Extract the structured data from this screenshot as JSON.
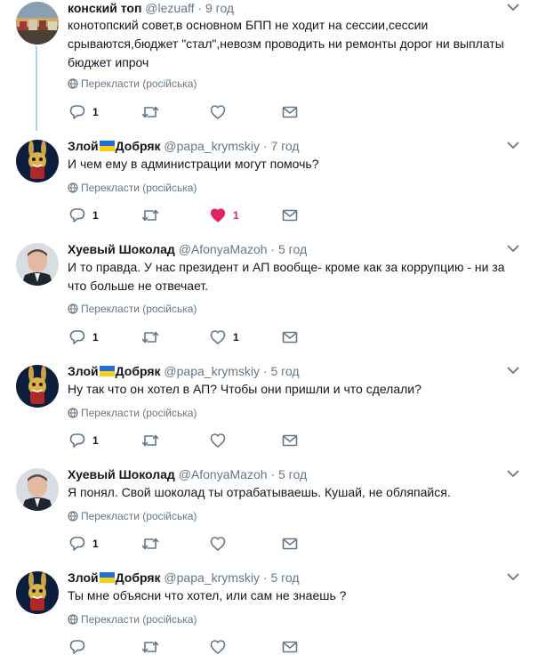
{
  "icons": {
    "reply": "reply-icon",
    "retweet": "retweet-icon",
    "like": "heart-icon",
    "liked": "heart-filled-icon",
    "dm": "envelope-icon",
    "globe": "globe-icon",
    "caret": "chevron-down-icon"
  },
  "colors": {
    "accent": "#1da1f2",
    "thread": "#9fd7f5",
    "muted": "#657786",
    "liked": "#e0245e"
  },
  "tweets": [
    {
      "name": "конский топ",
      "handle": "@lezuaff",
      "dot": "·",
      "time": "9 год",
      "text": "конотопский совет,в основном БПП не ходит на сессии,сессии срываются,бюджет \"стал\",невозм проводить ни ремонты дорог ни выплаты бюджет ипроч",
      "translate": "Перекласти (російська)",
      "reply_count": "1",
      "retweet_count": "",
      "like_count": "",
      "liked": false
    },
    {
      "name_part1": "Злой",
      "name_part2": "Добряк",
      "handle": "@papa_krymskiy",
      "dot": "·",
      "time": "7 год",
      "text": "И чем ему в администрации могут помочь?",
      "translate": "Перекласти (російська)",
      "reply_count": "1",
      "retweet_count": "",
      "like_count": "1",
      "liked": true
    },
    {
      "name": "Хуевый Шоколад",
      "handle": "@AfonyaMazoh",
      "dot": "·",
      "time": "5 год",
      "text": "И то правда. У нас президент и АП вообще- кроме как за коррупцию - ни за что больше не отвечает.",
      "translate": "Перекласти (російська)",
      "reply_count": "1",
      "retweet_count": "",
      "like_count": "1",
      "liked": false
    },
    {
      "name_part1": "Злой",
      "name_part2": "Добряк",
      "handle": "@papa_krymskiy",
      "dot": "·",
      "time": "5 год",
      "text": "Ну так что он хотел в АП? Чтобы они пришли и что сделали?",
      "translate": "Перекласти (російська)",
      "reply_count": "1",
      "retweet_count": "",
      "like_count": "",
      "liked": false
    },
    {
      "name": "Хуевый Шоколад",
      "handle": "@AfonyaMazoh",
      "dot": "·",
      "time": "5 год",
      "text": "Я понял. Свой шоколад ты отрабатываешь. Кушай, не обляпайся.",
      "translate": "Перекласти (російська)",
      "reply_count": "1",
      "retweet_count": "",
      "like_count": "",
      "liked": false
    },
    {
      "name_part1": "Злой",
      "name_part2": "Добряк",
      "handle": "@papa_krymskiy",
      "dot": "·",
      "time": "5 год",
      "text": "Ты мне объясни что хотел, или сам не знаешь ?",
      "translate": "Перекласти (російська)",
      "reply_count": "",
      "retweet_count": "",
      "like_count": "",
      "liked": false
    }
  ]
}
